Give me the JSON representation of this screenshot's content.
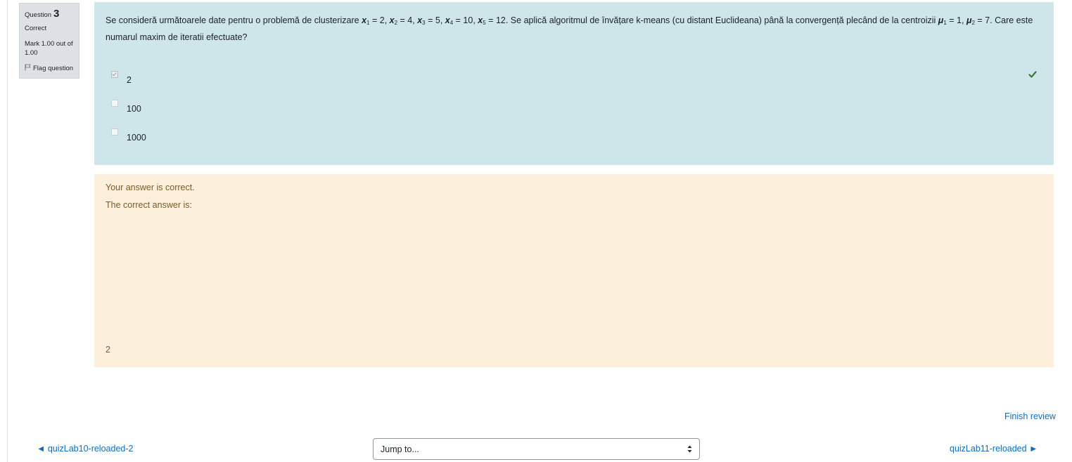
{
  "info": {
    "question_label": "Question",
    "question_number": "3",
    "state": "Correct",
    "grade": "Mark 1.00 out of 1.00",
    "flag_label": "Flag question",
    "flag_icon": "flag-icon"
  },
  "question": {
    "text_part1": "Se consideră următoarele date pentru o problemă de clusterizare ",
    "points": [
      {
        "var": "x",
        "sub": "1",
        "val": " = 2, "
      },
      {
        "var": "x",
        "sub": "2",
        "val": " = 4, "
      },
      {
        "var": "x",
        "sub": "3",
        "val": " = 5, "
      },
      {
        "var": "x",
        "sub": "4",
        "val": " = 10, "
      },
      {
        "var": "x",
        "sub": "5",
        "val": " = 12"
      }
    ],
    "text_part2": ". Se aplică algoritmul de învățare k-means (cu distant Euclideana) până la convergență plecând de la centroizii ",
    "centroids": [
      {
        "var": "μ",
        "sub": "1",
        "val": " = 1, "
      },
      {
        "var": "μ",
        "sub": "2",
        "val": " = 7"
      }
    ],
    "text_part3": ". Care este numarul maxim de iteratii efectuate?",
    "options": [
      {
        "label": "2",
        "checked": true
      },
      {
        "label": "100",
        "checked": false
      },
      {
        "label": "1000",
        "checked": false
      }
    ],
    "correct_icon": "check-icon",
    "correct_color": "#357a32"
  },
  "feedback": {
    "result": "Your answer is correct.",
    "correct_intro": "The correct answer is:",
    "correct_answer": "2"
  },
  "nav": {
    "finish_review": "Finish review",
    "prev_link": "◄ quizLab10-reloaded-2",
    "jump_to": "Jump to...",
    "next_link": "quizLab11-reloaded ►"
  },
  "colors": {
    "question_bg": "#cee6e9",
    "feedback_bg": "#fcefdc",
    "link": "#0f6cbf"
  }
}
